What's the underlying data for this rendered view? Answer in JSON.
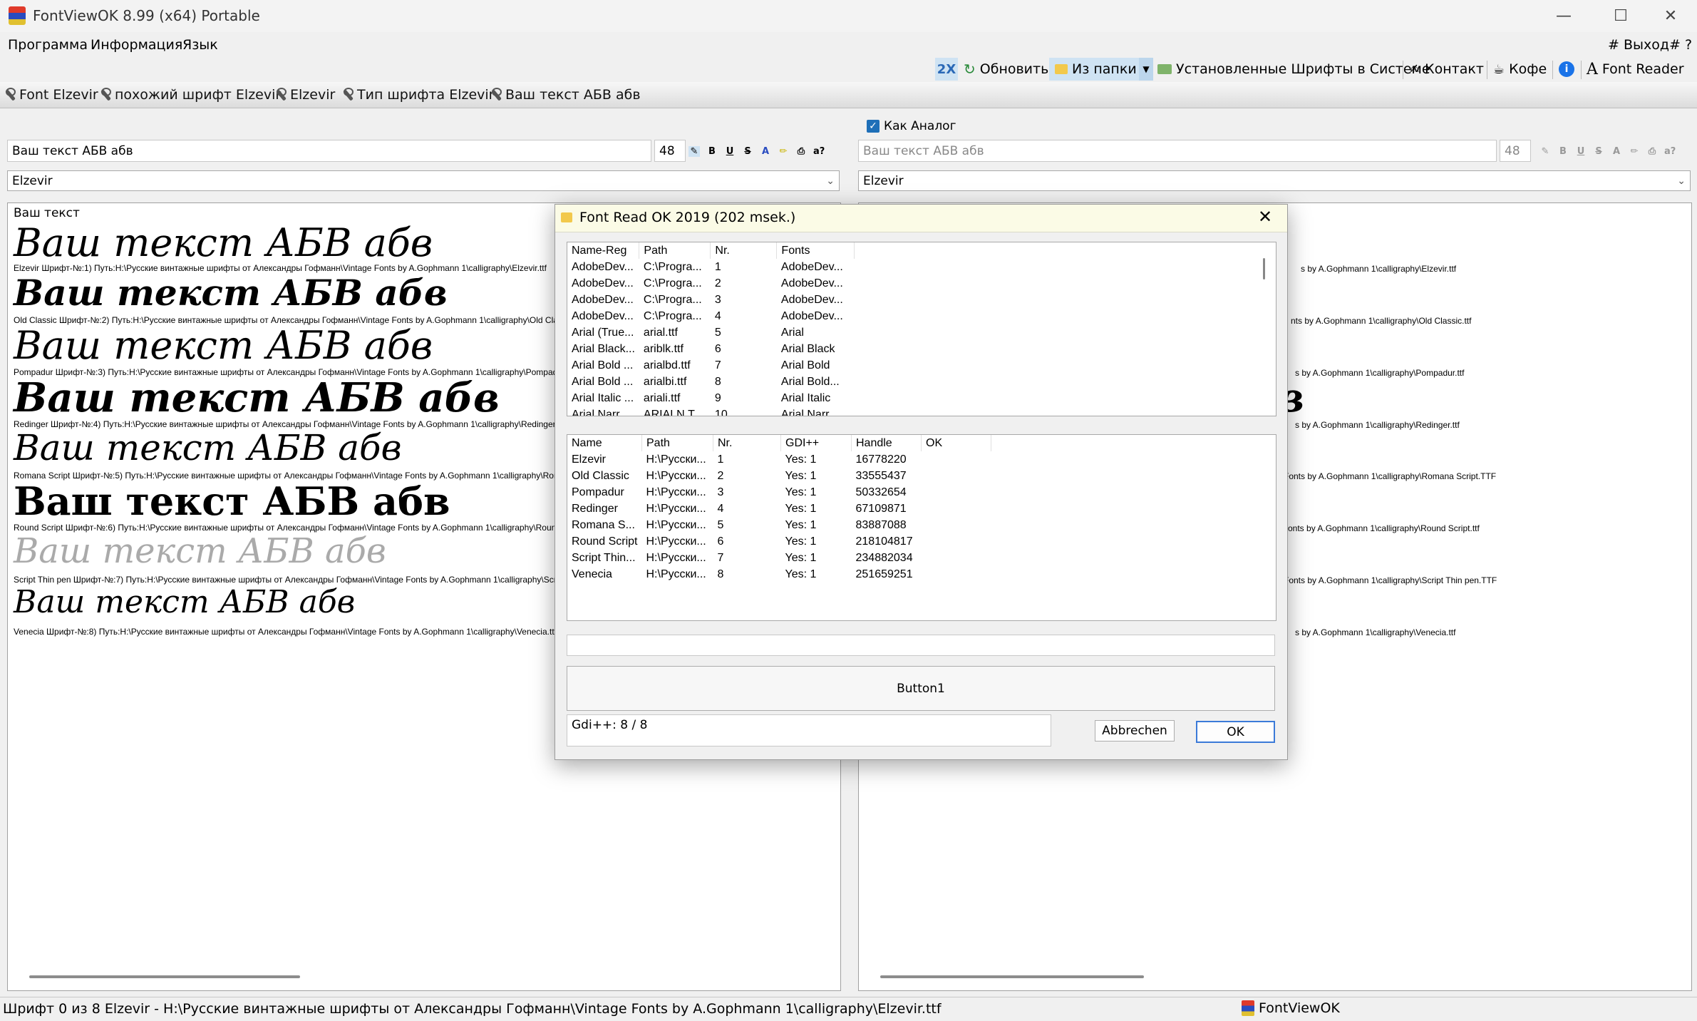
{
  "window": {
    "title": "FontViewOK 8.99  (x64) Portable",
    "minimize": "—",
    "maximize": "☐",
    "close": "✕"
  },
  "menu": {
    "items": [
      "Программа",
      "Информация",
      "Язык"
    ],
    "exit": "# Выход",
    "help": "# ?"
  },
  "toolbar": {
    "twox": "2X",
    "refresh": "Обновить",
    "from_folder": "Из папки",
    "installed": "Установленные Шрифты в Системе",
    "contact": "Контакт",
    "coffee": "Кофе",
    "font_reader": "Font Reader"
  },
  "quickbar": {
    "items": [
      "Font Elzevir",
      "похожий шрифт  Elzevir",
      "Elzevir",
      "Тип шрифта  Elzevir",
      "Ваш текст АБВ абв"
    ]
  },
  "left_panel": {
    "text_value": "Ваш текст АБВ абв",
    "size": "48",
    "font_combo": "Elzevir",
    "view_header": "Ваш текст",
    "samples": [
      {
        "text": "Ваш текст АБВ абв",
        "meta": "Elzevir Шрифт-№:1) Путь:H:\\Русские винтажные шрифты от  Александры Гофманн\\Vintage Fonts by A.Gophmann 1\\calligraphy\\Elzevir.ttf"
      },
      {
        "text": "Ваш текст АБВ абв",
        "meta": "Old Classic Шрифт-№:2) Путь:H:\\Русские винтажные шрифты от  Александры Гофманн\\Vintage Fonts by A.Gophmann 1\\calligraphy\\Old Classic.ttf"
      },
      {
        "text": "Ваш текст АБВ абв",
        "meta": "Pompadur Шрифт-№:3) Путь:H:\\Русские винтажные шрифты от  Александры Гофманн\\Vintage Fonts by A.Gophmann 1\\calligraphy\\Pompadur.ttf"
      },
      {
        "text": "Ваш текст АБВ абв",
        "meta": "Redinger Шрифт-№:4) Путь:H:\\Русские винтажные шрифты от  Александры Гофманн\\Vintage Fonts by A.Gophmann 1\\calligraphy\\Redinger.ttf"
      },
      {
        "text": "Ваш текст АБВ абв",
        "meta": "Romana Script Шрифт-№:5) Путь:H:\\Русские винтажные шрифты от  Александры Гофманн\\Vintage Fonts by A.Gophmann 1\\calligraphy\\Romana Script.TTF"
      },
      {
        "text": "Ваш текст АБВ абв",
        "meta": "Round Script Шрифт-№:6) Путь:H:\\Русские винтажные шрифты от  Александры Гофманн\\Vintage Fonts by A.Gophmann 1\\calligraphy\\Round Script.ttf"
      },
      {
        "text": "Ваш текст АБВ абв",
        "meta": "Script Thin pen Шрифт-№:7) Путь:H:\\Русские винтажные шрифты от  Александры Гофманн\\Vintage Fonts by A.Gophmann 1\\calligraphy\\Script Thin pen.TTF"
      },
      {
        "text": "Ваш текст АБВ абв",
        "meta": "Venecia Шрифт-№:8) Путь:H:\\Русские винтажные шрифты от  Александры Гофманн\\Vintage Fonts by A.Gophmann 1\\calligraphy\\Venecia.ttf"
      }
    ]
  },
  "right_panel": {
    "analog_label": "Как Аналог",
    "text_value": "Ваш текст АБВ абв",
    "size": "48",
    "font_combo": "Elzevir",
    "meta_tails": [
      "s by A.Gophmann 1\\calligraphy\\Elzevir.ttf",
      "nts by A.Gophmann 1\\calligraphy\\Old Classic.ttf",
      "s by A.Gophmann 1\\calligraphy\\Pompadur.ttf",
      "s by A.Gophmann 1\\calligraphy\\Redinger.ttf",
      "Fonts by A.Gophmann 1\\calligraphy\\Romana Script.TTF",
      "onts by A.Gophmann 1\\calligraphy\\Round Script.ttf",
      "Fonts by A.Gophmann 1\\calligraphy\\Script Thin pen.TTF",
      "s by A.Gophmann 1\\calligraphy\\Venecia.ttf"
    ]
  },
  "dialog": {
    "title": "Font Read OK 2019 (202 msek.)",
    "grid1": {
      "headers": [
        "Name-Reg",
        "Path",
        "Nr.",
        "Fonts"
      ],
      "rows": [
        [
          "AdobeDev...",
          "C:\\Progra...",
          "1",
          "AdobeDev..."
        ],
        [
          "AdobeDev...",
          "C:\\Progra...",
          "2",
          "AdobeDev..."
        ],
        [
          "AdobeDev...",
          "C:\\Progra...",
          "3",
          "AdobeDev..."
        ],
        [
          "AdobeDev...",
          "C:\\Progra...",
          "4",
          "AdobeDev..."
        ],
        [
          "Arial (True...",
          "arial.ttf",
          "5",
          "Arial"
        ],
        [
          "Arial Black...",
          "ariblk.ttf",
          "6",
          "Arial Black"
        ],
        [
          "Arial Bold ...",
          "arialbd.ttf",
          "7",
          "Arial Bold"
        ],
        [
          "Arial Bold ...",
          "arialbi.ttf",
          "8",
          "Arial Bold..."
        ],
        [
          "Arial Italic ...",
          "ariali.ttf",
          "9",
          "Arial Italic"
        ],
        [
          "Arial Narr...",
          "ARIALN.T...",
          "10",
          "Arial Narr..."
        ]
      ]
    },
    "grid2": {
      "headers": [
        "Name",
        "Path",
        "Nr.",
        "GDI++",
        "Handle",
        "OK"
      ],
      "rows": [
        [
          "Elzevir",
          "H:\\Русски...",
          "1",
          "Yes: 1",
          "16778220",
          ""
        ],
        [
          "Old Classic",
          "H:\\Русски...",
          "2",
          "Yes: 1",
          "33555437",
          ""
        ],
        [
          "Pompadur",
          "H:\\Русски...",
          "3",
          "Yes: 1",
          "50332654",
          ""
        ],
        [
          "Redinger",
          "H:\\Русски...",
          "4",
          "Yes: 1",
          "67109871",
          ""
        ],
        [
          "Romana S...",
          "H:\\Русски...",
          "5",
          "Yes: 1",
          "83887088",
          ""
        ],
        [
          "Round Script",
          "H:\\Русски...",
          "6",
          "Yes: 1",
          "218104817",
          ""
        ],
        [
          "Script Thin...",
          "H:\\Русски...",
          "7",
          "Yes: 1",
          "234882034",
          ""
        ],
        [
          "Venecia",
          "H:\\Русски...",
          "8",
          "Yes: 1",
          "251659251",
          ""
        ]
      ]
    },
    "button1": "Button1",
    "gdi_status": "Gdi++: 8 / 8",
    "cancel": "Abbrechen",
    "ok": "OK"
  },
  "status": {
    "text": "Шрифт 0 из 8 Elzevir - H:\\Русские винтажные шрифты от  Александры Гофманн\\Vintage Fonts by A.Gophmann 1\\calligraphy\\Elzevir.ttf",
    "app": "FontViewOK"
  },
  "colors": {
    "accent": "#3b7ad8",
    "dialog_title_bg": "#fbfbe6",
    "checkbox": "#1e6fb8",
    "info_icon": "#1a73e8"
  }
}
